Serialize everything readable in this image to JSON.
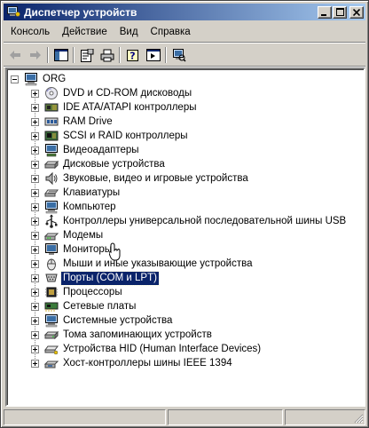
{
  "window": {
    "title": "Диспетчер устройств"
  },
  "title_buttons": {
    "minimize": "_",
    "maximize": "□",
    "close": "×"
  },
  "menu": [
    "Консоль",
    "Действие",
    "Вид",
    "Справка"
  ],
  "toolbar": {
    "buttons": [
      "back-arrow-icon",
      "forward-arrow-icon",
      "console-tree-icon",
      "properties-icon",
      "print-icon",
      "help-icon",
      "show-hide-icon",
      "scan-hardware-icon"
    ]
  },
  "tree": {
    "root": {
      "label": "ORG",
      "icon": "computer-icon"
    },
    "items": [
      {
        "label": "DVD и CD-ROM дисководы",
        "icon": "cdrom-icon"
      },
      {
        "label": "IDE ATA/ATAPI контроллеры",
        "icon": "ide-controller-icon"
      },
      {
        "label": "RAM Drive",
        "icon": "ram-drive-icon"
      },
      {
        "label": "SCSI и RAID контроллеры",
        "icon": "scsi-controller-icon"
      },
      {
        "label": "Видеоадаптеры",
        "icon": "video-adapter-icon"
      },
      {
        "label": "Дисковые устройства",
        "icon": "disk-drive-icon"
      },
      {
        "label": "Звуковые, видео и игровые устройства",
        "icon": "sound-device-icon"
      },
      {
        "label": "Клавиатуры",
        "icon": "keyboard-icon"
      },
      {
        "label": "Компьютер",
        "icon": "computer-icon"
      },
      {
        "label": "Контроллеры универсальной последовательной шины USB",
        "icon": "usb-icon"
      },
      {
        "label": "Модемы",
        "icon": "modem-icon"
      },
      {
        "label": "Мониторы",
        "icon": "monitor-icon"
      },
      {
        "label": "Мыши и иные указывающие устройства",
        "icon": "mouse-icon"
      },
      {
        "label": "Порты (COM и LPT)",
        "icon": "port-icon",
        "selected": true
      },
      {
        "label": "Процессоры",
        "icon": "processor-icon"
      },
      {
        "label": "Сетевые платы",
        "icon": "network-card-icon"
      },
      {
        "label": "Системные устройства",
        "icon": "system-device-icon"
      },
      {
        "label": "Тома запоминающих устройств",
        "icon": "storage-volume-icon"
      },
      {
        "label": "Устройства HID (Human Interface Devices)",
        "icon": "hid-icon"
      },
      {
        "label": "Хост-контроллеры шины IEEE 1394",
        "icon": "ieee1394-icon"
      }
    ]
  },
  "colors": {
    "titlebar_start": "#0a246a",
    "titlebar_end": "#a6caf0",
    "selection": "#0a246a",
    "face": "#d4d0c8"
  }
}
